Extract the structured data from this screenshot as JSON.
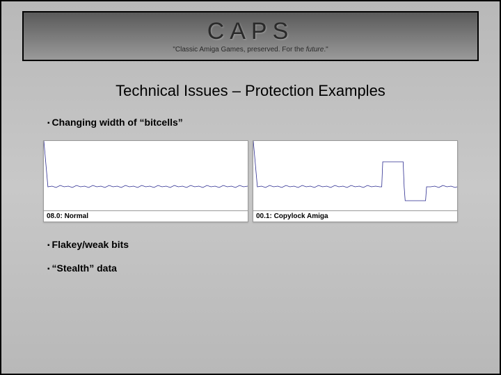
{
  "header": {
    "logo": "CAPS",
    "tagline_prefix": "\"Classic Amiga Games, preserved. For the ",
    "tagline_emph": "future",
    "tagline_suffix": ".\""
  },
  "title": "Technical Issues – Protection Examples",
  "bullets": {
    "b1": "Changing width of “bitcells”",
    "b2": "Flakey/weak bits",
    "b3": "“Stealth” data"
  },
  "chart_data": [
    {
      "type": "line",
      "label": "08.0: Normal",
      "title": "",
      "xlabel": "",
      "ylabel": "",
      "ylim": [
        0,
        100
      ],
      "x": [
        0,
        2,
        4,
        6,
        8,
        10,
        12,
        14,
        16,
        18,
        20,
        22,
        24,
        26,
        28,
        30,
        32,
        34,
        36,
        38,
        40,
        42,
        44,
        46,
        48,
        50,
        52,
        54,
        56,
        58,
        60,
        62,
        64,
        66,
        68,
        70,
        72,
        74,
        76,
        78,
        80,
        82,
        84,
        86,
        88,
        90,
        92,
        94,
        96,
        98,
        100
      ],
      "values": [
        100,
        34,
        35,
        33,
        36,
        34,
        35,
        33,
        36,
        34,
        35,
        33,
        36,
        34,
        35,
        33,
        36,
        34,
        35,
        33,
        36,
        34,
        35,
        33,
        36,
        34,
        35,
        33,
        36,
        34,
        35,
        33,
        36,
        34,
        35,
        33,
        36,
        34,
        35,
        33,
        36,
        34,
        35,
        33,
        36,
        34,
        35,
        33,
        36,
        34,
        35
      ]
    },
    {
      "type": "line",
      "label": "00.1: Copylock Amiga",
      "title": "",
      "xlabel": "",
      "ylabel": "",
      "ylim": [
        0,
        100
      ],
      "x": [
        0,
        2,
        4,
        6,
        8,
        10,
        12,
        14,
        16,
        18,
        20,
        22,
        24,
        26,
        28,
        30,
        32,
        34,
        36,
        38,
        40,
        42,
        44,
        46,
        48,
        50,
        52,
        54,
        56,
        58,
        60,
        62,
        63,
        63.5,
        73.5,
        74,
        74.5,
        84.5,
        85,
        87,
        89,
        91,
        93,
        95,
        97,
        99,
        100
      ],
      "values": [
        100,
        34,
        35,
        33,
        36,
        34,
        35,
        33,
        36,
        34,
        35,
        33,
        36,
        34,
        35,
        33,
        36,
        34,
        35,
        33,
        36,
        34,
        35,
        33,
        36,
        34,
        35,
        33,
        36,
        34,
        35,
        34,
        34,
        70,
        70,
        34,
        14,
        14,
        34,
        34,
        35,
        33,
        36,
        34,
        35,
        33,
        34
      ]
    }
  ]
}
